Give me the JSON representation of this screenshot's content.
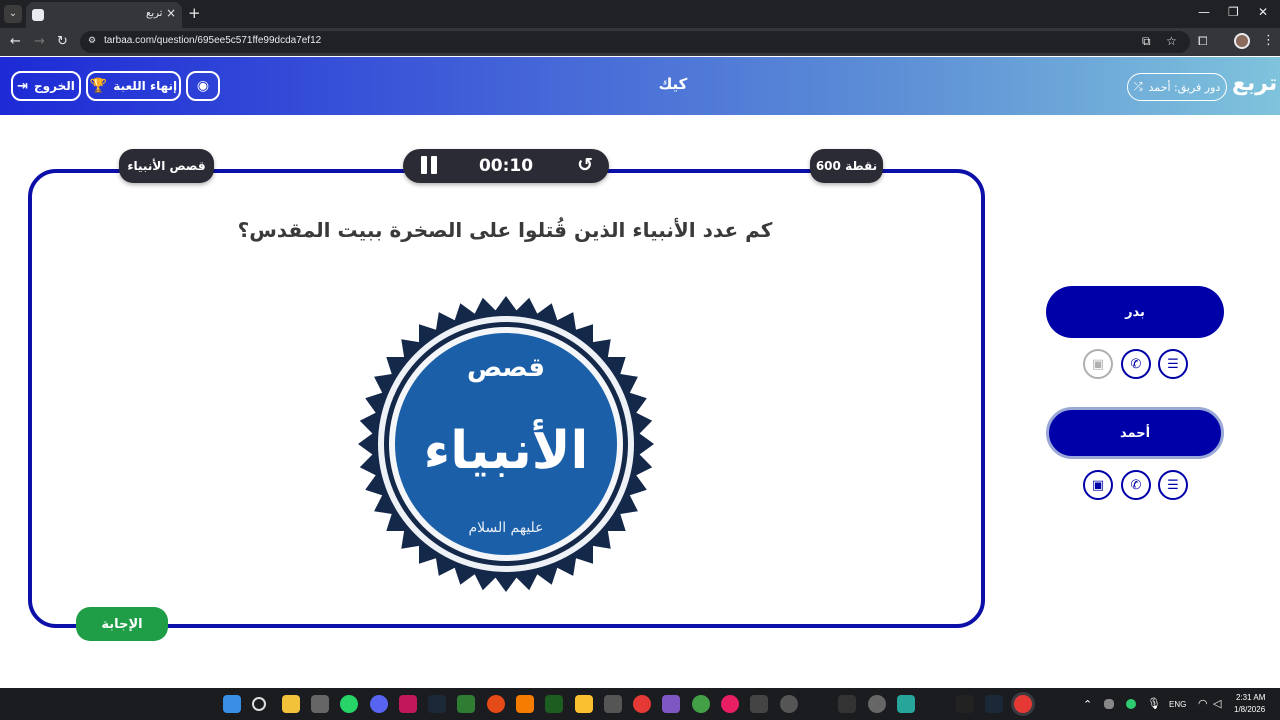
{
  "browser": {
    "tab_title": "تربع",
    "tab_close": "×",
    "new_tab": "+",
    "url": "tarbaa.com/question/695ee5c571ffe99dcda7ef12",
    "win_minimize": "—",
    "win_restore": "❐",
    "win_close": "✕"
  },
  "header": {
    "exit_label": "الخروج",
    "end_game_label": "إنهاء اللعبة",
    "title": "كيك",
    "turn_label": "دور فريق: أحمد",
    "logo": "تربع"
  },
  "question": {
    "category": "قصص الأنبياء",
    "timer": "00:10",
    "points": "600 نقطة",
    "text": "كم عدد الأنبياء الذين قُتلوا على الصخرة ببيت المقدس؟",
    "seal_text_top": "قصص",
    "seal_text_main": "الأنبياء",
    "seal_text_bottom": "عليهم السلام",
    "answer_label": "الإجابة"
  },
  "teams": [
    {
      "name": "بدر",
      "active": false
    },
    {
      "name": "أحمد",
      "active": true
    }
  ],
  "taskbar": {
    "lang": "ENG",
    "time": "2:31 AM",
    "date": "1/8/2026"
  },
  "colors": {
    "card_border": "#0d10a8",
    "team_bg": "#0000a8",
    "answer_bg": "#1f9e47",
    "seal_blue": "#1a5fa8",
    "seal_dark": "#14284a"
  }
}
